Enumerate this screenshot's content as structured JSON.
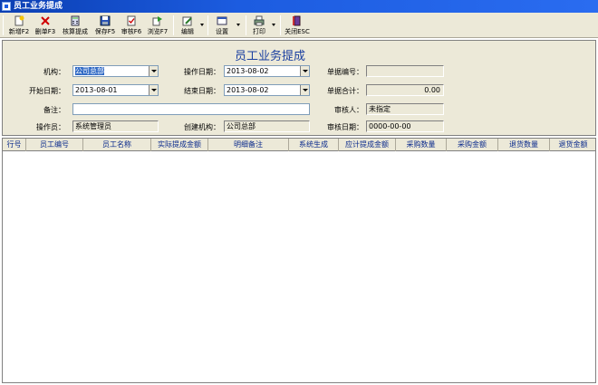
{
  "window": {
    "title": "员工业务提成"
  },
  "toolbar": {
    "new": "新增F2",
    "delete": "删单F3",
    "calc": "核算提成",
    "save": "保存F5",
    "audit": "审核F6",
    "browse": "浏览F7",
    "edit": "编辑",
    "settings": "设置",
    "print": "打印",
    "close": "关闭ESC"
  },
  "form": {
    "title": "员工业务提成",
    "org_label": "机构：",
    "org_value": "公司总部",
    "op_date_label": "操作日期：",
    "op_date_value": "2013-08-02",
    "doc_no_label": "单据编号：",
    "doc_no_value": "",
    "start_date_label": "开始日期：",
    "start_date_value": "2013-08-01",
    "end_date_label": "结束日期：",
    "end_date_value": "2013-08-02",
    "doc_total_label": "单据合计：",
    "doc_total_value": "0.00",
    "remark_label": "备注：",
    "remark_value": "",
    "auditor_label": "审核人：",
    "auditor_value": "未指定",
    "operator_label": "操作员：",
    "operator_value": "系统管理员",
    "creator_org_label": "创建机构：",
    "creator_org_value": "公司总部",
    "audit_date_label": "审核日期：",
    "audit_date_value": "0000-00-00"
  },
  "grid": {
    "columns": [
      "行号",
      "员工编号",
      "员工名称",
      "实际提成金额",
      "明细备注",
      "系统生成",
      "应计提成金额",
      "采购数量",
      "采购金额",
      "退货数量",
      "退货金额"
    ]
  }
}
